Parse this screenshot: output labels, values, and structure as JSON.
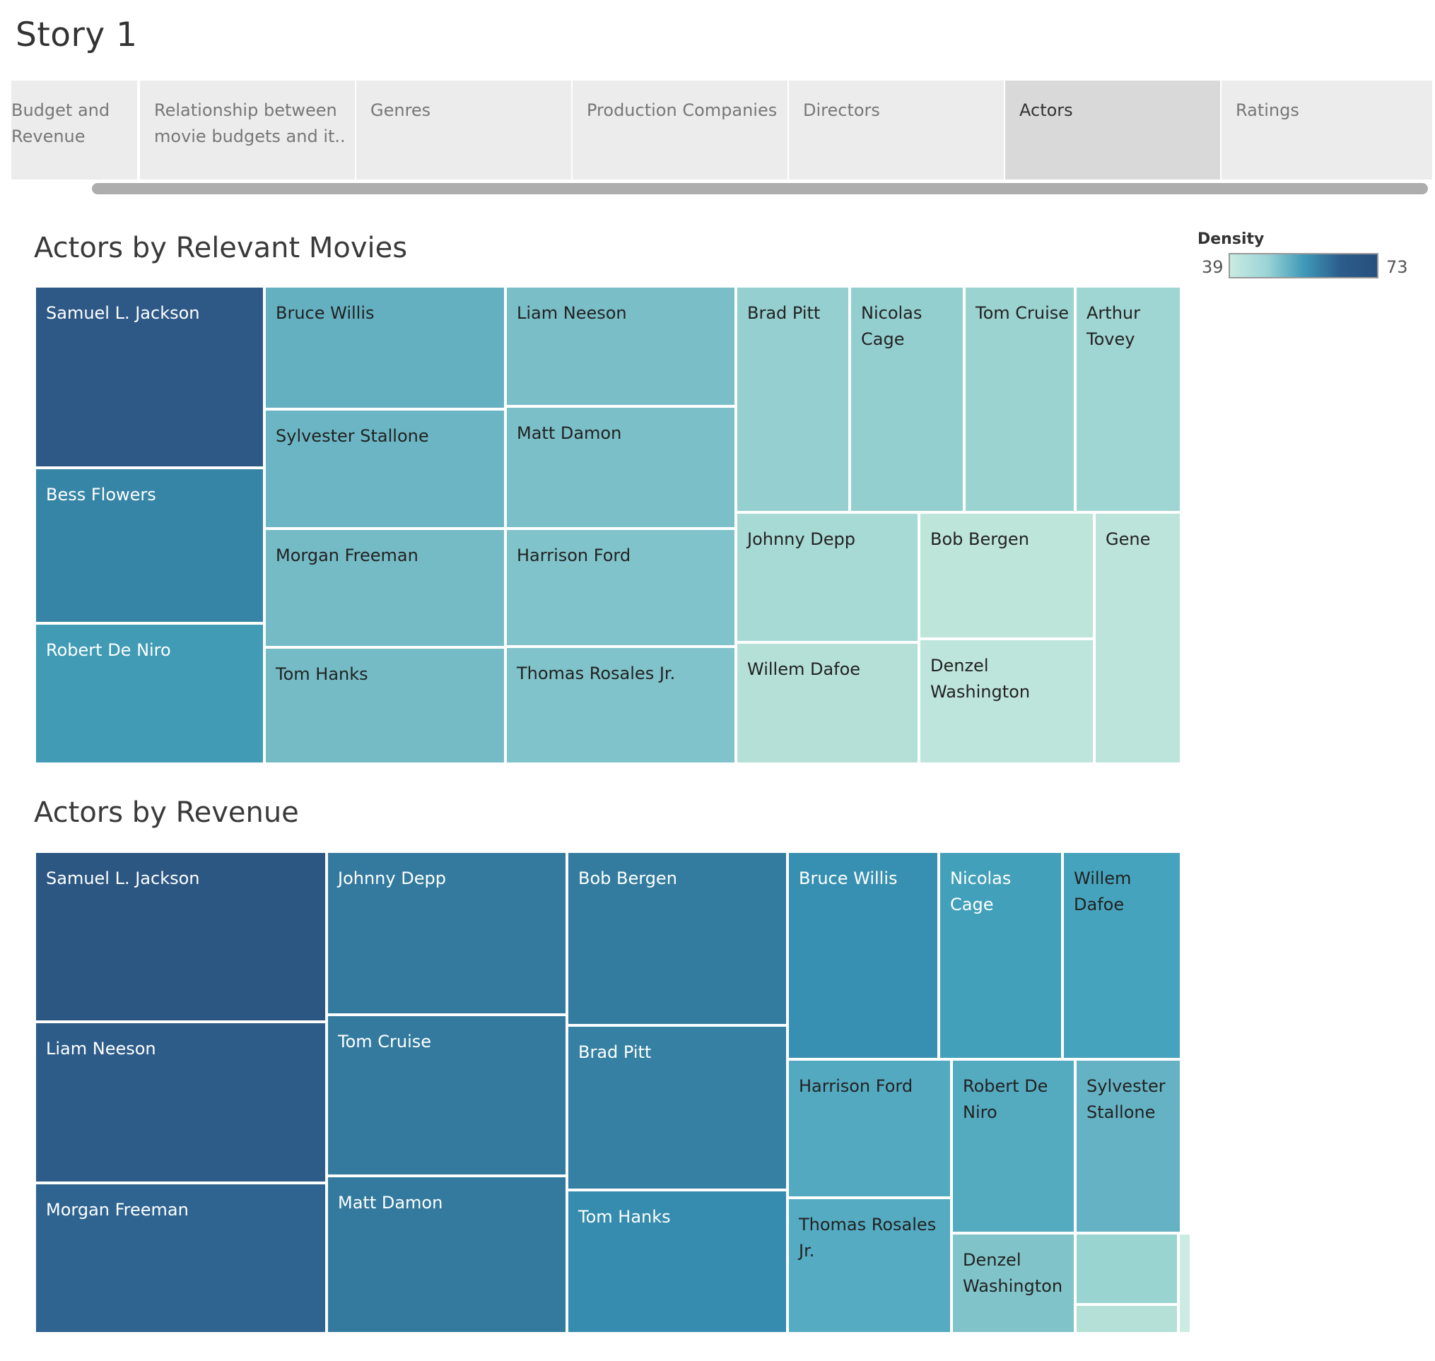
{
  "story": {
    "title": "Story 1"
  },
  "tabs": [
    {
      "label": "Budget and\nRevenue",
      "active": false
    },
    {
      "label": "Relationship between\nmovie budgets and it..",
      "active": false
    },
    {
      "label": "Genres",
      "active": false
    },
    {
      "label": "Production Companies",
      "active": false
    },
    {
      "label": "Directors",
      "active": false
    },
    {
      "label": "Actors",
      "active": true
    },
    {
      "label": "Ratings",
      "active": false
    }
  ],
  "legend": {
    "title": "Density",
    "min": "39",
    "max": "73",
    "colors": [
      "#c9ebe2",
      "#9cd4d6",
      "#3f9ab8",
      "#2c5d8c",
      "#274f7d"
    ]
  },
  "movies_sheet": {
    "title": "Actors by Relevant Movies",
    "cells": [
      {
        "label": "Samuel L. Jackson",
        "color": "#2e5986",
        "text": "#ffffff"
      },
      {
        "label": "Bess Flowers",
        "color": "#3785a6",
        "text": "#ffffff"
      },
      {
        "label": "Robert De Niro",
        "color": "#419bb5",
        "text": "#ffffff"
      },
      {
        "label": "Bruce Willis",
        "color": "#64b0c1",
        "text": "#222222"
      },
      {
        "label": "Sylvester Stallone",
        "color": "#6bb5c4",
        "text": "#222222"
      },
      {
        "label": "Morgan Freeman",
        "color": "#74bbc6",
        "text": "#222222"
      },
      {
        "label": "Tom Hanks",
        "color": "#74bbc6",
        "text": "#222222"
      },
      {
        "label": "Liam Neeson",
        "color": "#7abec8",
        "text": "#222222"
      },
      {
        "label": "Matt Damon",
        "color": "#7bbfc8",
        "text": "#222222"
      },
      {
        "label": "Harrison Ford",
        "color": "#80c3ca",
        "text": "#222222"
      },
      {
        "label": "Thomas Rosales Jr.",
        "color": "#80c3ca",
        "text": "#222222"
      },
      {
        "label": "Brad Pitt",
        "color": "#95cfd0",
        "text": "#222222"
      },
      {
        "label": "Nicolas\nCage",
        "color": "#94cfd0",
        "text": "#222222"
      },
      {
        "label": "Tom Cruise",
        "color": "#9bd3d1",
        "text": "#222222"
      },
      {
        "label": "Arthur\nTovey",
        "color": "#9fd5d2",
        "text": "#222222"
      },
      {
        "label": "Johnny Depp",
        "color": "#a7dad5",
        "text": "#222222"
      },
      {
        "label": "Willem Dafoe",
        "color": "#b5e0d8",
        "text": "#222222"
      },
      {
        "label": "Bob Bergen",
        "color": "#bde5da",
        "text": "#222222"
      },
      {
        "label": "Denzel\nWashington",
        "color": "#bee5db",
        "text": "#222222"
      },
      {
        "label": "Gene",
        "color": "#bce4da",
        "text": "#222222"
      }
    ]
  },
  "revenue_sheet": {
    "title": "Actors by Revenue",
    "cells": [
      {
        "label": "Samuel L. Jackson",
        "color": "#2c5783",
        "text": "#ffffff"
      },
      {
        "label": "Liam Neeson",
        "color": "#2e5c89",
        "text": "#ffffff"
      },
      {
        "label": "Morgan Freeman",
        "color": "#2f6490",
        "text": "#ffffff"
      },
      {
        "label": "Johnny Depp",
        "color": "#347a9f",
        "text": "#ffffff"
      },
      {
        "label": "Tom Cruise",
        "color": "#347a9f",
        "text": "#ffffff"
      },
      {
        "label": "Matt Damon",
        "color": "#347a9f",
        "text": "#ffffff"
      },
      {
        "label": "Bob Bergen",
        "color": "#347c9f",
        "text": "#ffffff"
      },
      {
        "label": "Brad Pitt",
        "color": "#3580a3",
        "text": "#ffffff"
      },
      {
        "label": "Tom Hanks",
        "color": "#368cae",
        "text": "#ffffff"
      },
      {
        "label": "Bruce Willis",
        "color": "#3790b1",
        "text": "#ffffff"
      },
      {
        "label": "Nicolas\nCage",
        "color": "#43a0bb",
        "text": "#ffffff"
      },
      {
        "label": "Willem\nDafoe",
        "color": "#46a3bd",
        "text": "#222222"
      },
      {
        "label": "Harrison Ford",
        "color": "#53aac0",
        "text": "#222222"
      },
      {
        "label": "Thomas Rosales\nJr.",
        "color": "#55abc1",
        "text": "#222222"
      },
      {
        "label": "Robert De\nNiro",
        "color": "#54abc0",
        "text": "#222222"
      },
      {
        "label": "Sylvester\nStallone",
        "color": "#64b2c3",
        "text": "#222222"
      },
      {
        "label": "Denzel\nWashington",
        "color": "#80c4ca",
        "text": "#222222"
      },
      {
        "label": "",
        "color": "#9ad4d1",
        "text": "#222222"
      },
      {
        "label": "",
        "color": "#b4e0d8",
        "text": "#222222"
      },
      {
        "label": "",
        "color": "#ccece3",
        "text": "#222222"
      }
    ]
  }
}
